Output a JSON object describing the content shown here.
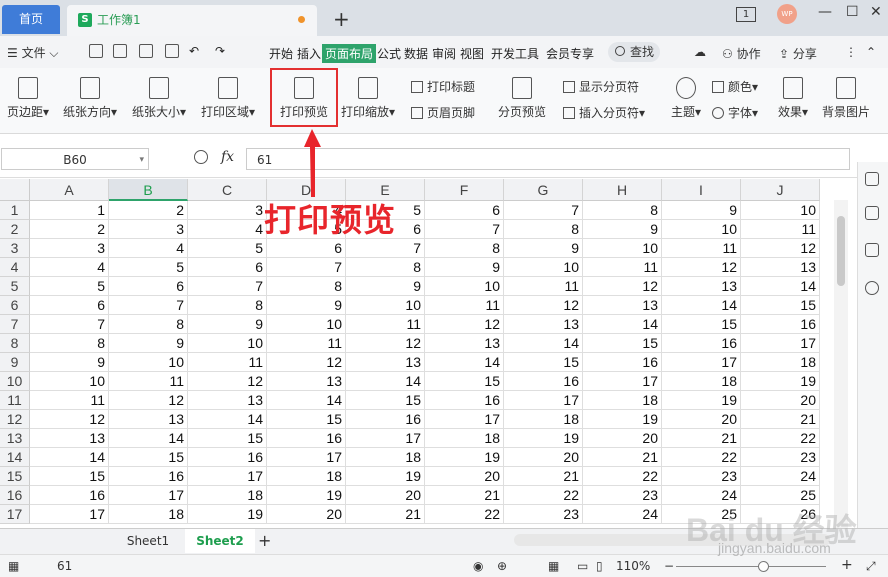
{
  "titlebar": {
    "home_tab": "首页",
    "doc_icon": "S",
    "doc_tab": "工作簿1",
    "window_count": "1",
    "avatar_text": "WP"
  },
  "menubar": {
    "file": "文件",
    "tabs": [
      "开始",
      "插入",
      "页面布局",
      "公式",
      "数据",
      "审阅",
      "视图",
      "开发工具",
      "会员专享"
    ],
    "active_tab": "页面布局",
    "search": "查找",
    "collab": "协作",
    "share": "分享"
  },
  "ribbon": {
    "margins": "页边距",
    "orientation": "纸张方向",
    "size": "纸张大小",
    "print_area": "打印区域",
    "print_preview": "打印预览",
    "print_scale": "打印缩放",
    "print_titles": "打印标题",
    "header_footer": "页眉页脚",
    "page_break_preview": "分页预览",
    "show_page_break": "显示分页符",
    "insert_page_break": "插入分页符",
    "theme": "主题",
    "colors": "颜色",
    "fonts": "字体",
    "effects": "效果",
    "background": "背景图片"
  },
  "formula": {
    "name_box": "B60",
    "fx": "fx",
    "value": "61"
  },
  "grid": {
    "columns": [
      "A",
      "B",
      "C",
      "D",
      "E",
      "F",
      "G",
      "H",
      "I",
      "J"
    ],
    "selected_column": "B",
    "rows": [
      [
        1,
        2,
        3,
        4,
        5,
        6,
        7,
        8,
        9,
        10
      ],
      [
        2,
        3,
        4,
        5,
        6,
        7,
        8,
        9,
        10,
        11
      ],
      [
        3,
        4,
        5,
        6,
        7,
        8,
        9,
        10,
        11,
        12
      ],
      [
        4,
        5,
        6,
        7,
        8,
        9,
        10,
        11,
        12,
        13
      ],
      [
        5,
        6,
        7,
        8,
        9,
        10,
        11,
        12,
        13,
        14
      ],
      [
        6,
        7,
        8,
        9,
        10,
        11,
        12,
        13,
        14,
        15
      ],
      [
        7,
        8,
        9,
        10,
        11,
        12,
        13,
        14,
        15,
        16
      ],
      [
        8,
        9,
        10,
        11,
        12,
        13,
        14,
        15,
        16,
        17
      ],
      [
        9,
        10,
        11,
        12,
        13,
        14,
        15,
        16,
        17,
        18
      ],
      [
        10,
        11,
        12,
        13,
        14,
        15,
        16,
        17,
        18,
        19
      ],
      [
        11,
        12,
        13,
        14,
        15,
        16,
        17,
        18,
        19,
        20
      ],
      [
        12,
        13,
        14,
        15,
        16,
        17,
        18,
        19,
        20,
        21
      ],
      [
        13,
        14,
        15,
        16,
        17,
        18,
        19,
        20,
        21,
        22
      ],
      [
        14,
        15,
        16,
        17,
        18,
        19,
        20,
        21,
        22,
        23
      ],
      [
        15,
        16,
        17,
        18,
        19,
        20,
        21,
        22,
        23,
        24
      ],
      [
        16,
        17,
        18,
        19,
        20,
        21,
        22,
        23,
        24,
        25
      ],
      [
        17,
        18,
        19,
        20,
        21,
        22,
        23,
        24,
        25,
        26
      ]
    ]
  },
  "sheets": {
    "tabs": [
      "Sheet1",
      "Sheet2"
    ],
    "active": "Sheet2"
  },
  "status": {
    "cell_value": "61",
    "zoom": "110%"
  },
  "annotation": {
    "label": "打印预览"
  },
  "watermark": {
    "text": "Bai du 经验",
    "sub": "jingyan.baidu.com"
  },
  "colors": {
    "accent_green": "#2ea36b",
    "home_blue": "#3f7cd8",
    "annotation_red": "#e33030"
  }
}
